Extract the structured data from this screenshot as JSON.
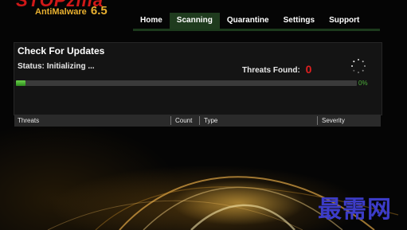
{
  "app": {
    "logo_text": "STOPzilla",
    "product_name": "AntiMalware",
    "version": "6.5"
  },
  "nav": {
    "items": [
      {
        "label": "Home",
        "active": false
      },
      {
        "label": "Scanning",
        "active": true
      },
      {
        "label": "Quarantine",
        "active": false
      },
      {
        "label": "Settings",
        "active": false
      },
      {
        "label": "Support",
        "active": false
      }
    ]
  },
  "update_panel": {
    "title": "Check For Updates",
    "status_label": "Status:",
    "status_value": "Initializing ...",
    "threats_label": "Threats Found:",
    "threats_count": "0",
    "progress_percent_text": "0%",
    "progress_fraction": 0.0
  },
  "threats_table": {
    "columns": [
      "Threats",
      "Count",
      "Type",
      "Severity"
    ],
    "rows": []
  },
  "watermark": "最需网",
  "colors": {
    "accent_green": "#1f3b1e",
    "threat_red": "#e02020",
    "progress_green": "#4caf3a",
    "logo_gold": "#e8b030",
    "watermark_blue": "#3c3cc8"
  }
}
